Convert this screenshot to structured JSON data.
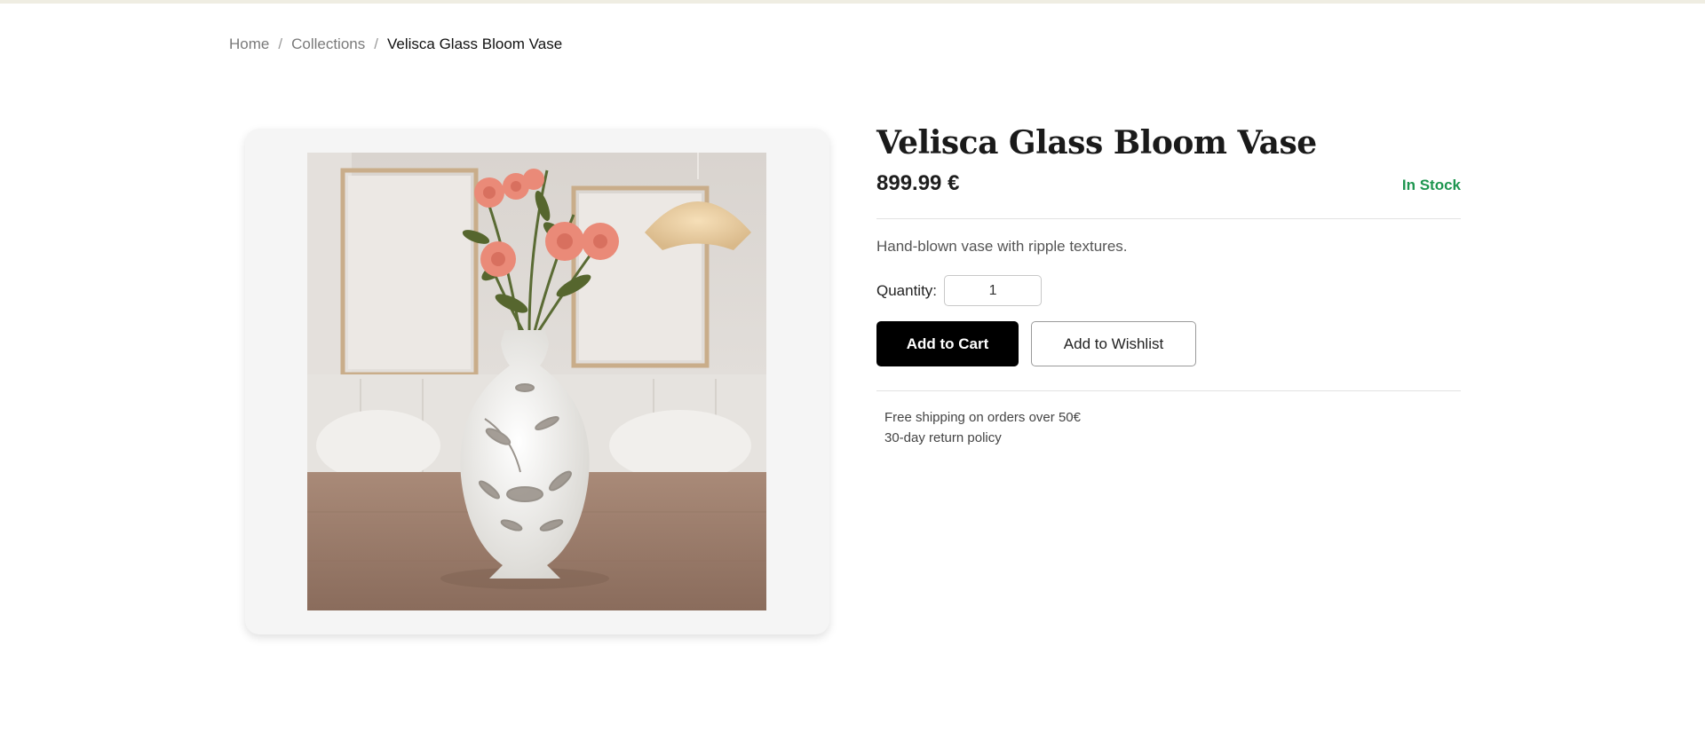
{
  "breadcrumb": {
    "home": "Home",
    "separator": "/",
    "collections": "Collections",
    "current": "Velisca Glass Bloom Vase"
  },
  "product": {
    "title": "Velisca Glass Bloom Vase",
    "price": "899.99 €",
    "stock_status": "In Stock",
    "description": "Hand-blown vase with ripple textures.",
    "image_alt": "Velisca Glass Bloom Vase"
  },
  "quantity": {
    "label": "Quantity:",
    "value": "1"
  },
  "actions": {
    "add_to_cart": "Add to Cart",
    "add_to_wishlist": "Add to Wishlist"
  },
  "policies": {
    "shipping": "Free shipping on orders over 50€",
    "returns": "30-day return policy"
  },
  "colors": {
    "stock_green": "#1e9650",
    "cart_button": "#000000",
    "card_background": "#f5f5f5"
  }
}
